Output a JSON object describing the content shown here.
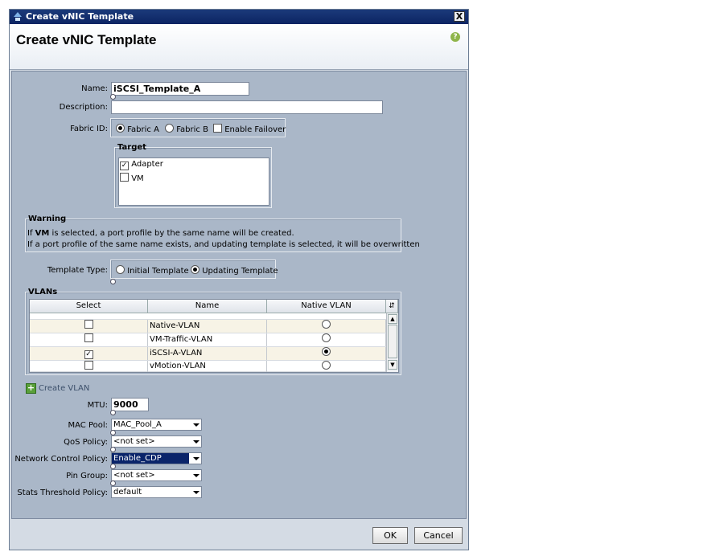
{
  "window": {
    "title": "Create vNIC Template",
    "close_label": "X"
  },
  "header": {
    "title": "Create vNIC Template",
    "help_label": "?"
  },
  "form": {
    "name": {
      "label": "Name:",
      "value": "iSCSI_Template_A"
    },
    "description": {
      "label": "Description:",
      "value": ""
    },
    "fabric": {
      "label": "Fabric ID:",
      "options": [
        "Fabric A",
        "Fabric B"
      ],
      "selected": "Fabric A",
      "failover_label": "Enable Failover",
      "failover_checked": false
    },
    "target": {
      "legend": "Target",
      "items": [
        {
          "label": "Adapter",
          "checked": true
        },
        {
          "label": "VM",
          "checked": false
        }
      ]
    },
    "warning": {
      "legend": "Warning",
      "line1_prefix": "If ",
      "line1_bold": "VM",
      "line1_suffix": " is selected, a port profile by the same name will be created.",
      "line2": "If a port profile of the same name exists, and updating template is selected, it will be overwritten"
    },
    "template_type": {
      "label": "Template Type:",
      "options": [
        "Initial Template",
        "Updating Template"
      ],
      "selected": "Updating Template"
    },
    "vlans": {
      "legend": "VLANs",
      "columns": [
        "Select",
        "Name",
        "Native VLAN"
      ],
      "rows": [
        {
          "name": "Native-VLAN",
          "selected": false,
          "native": false
        },
        {
          "name": "VM-Traffic-VLAN",
          "selected": false,
          "native": false
        },
        {
          "name": "iSCSI-A-VLAN",
          "selected": true,
          "native": true
        },
        {
          "name": "vMotion-VLAN",
          "selected": false,
          "native": false
        }
      ]
    },
    "create_vlan_label": "Create VLAN",
    "mtu": {
      "label": "MTU:",
      "value": "9000"
    },
    "mac_pool": {
      "label": "MAC Pool:",
      "value": "MAC_Pool_A"
    },
    "qos_policy": {
      "label": "QoS Policy:",
      "value": "<not set>"
    },
    "network_control_policy": {
      "label": "Network Control Policy:",
      "value": "Enable_CDP"
    },
    "pin_group": {
      "label": "Pin Group:",
      "value": "<not set>"
    },
    "stats_threshold_policy": {
      "label": "Stats Threshold Policy:",
      "value": "default"
    }
  },
  "footer": {
    "ok_label": "OK",
    "cancel_label": "Cancel"
  },
  "colors": {
    "titlebar": "#0c2463",
    "panel": "#aab7c8",
    "selection": "#0a246a",
    "plus_icon": "#5aa03a"
  }
}
